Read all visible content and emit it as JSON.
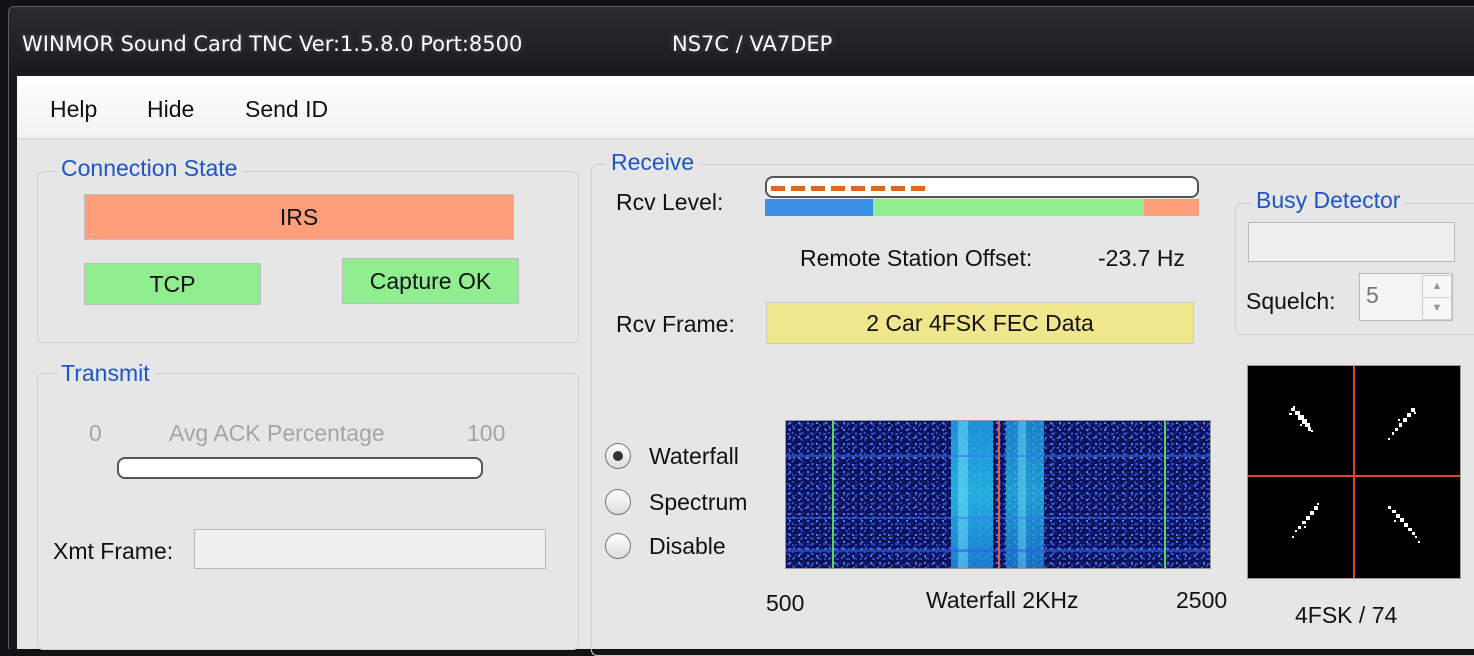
{
  "titlebar": {
    "title": "WINMOR Sound Card TNC Ver:1.5.8.0 Port:8500",
    "callsigns": "NS7C / VA7DEP"
  },
  "menu": {
    "items": [
      "Help",
      "Hide",
      "Send ID"
    ]
  },
  "connection_state": {
    "group_label": "Connection State",
    "state": "IRS",
    "tcp": "TCP",
    "capture": "Capture OK",
    "colors": {
      "irs": "#ff9e7a",
      "ok": "#90ee90"
    }
  },
  "transmit": {
    "group_label": "Transmit",
    "ack_min": "0",
    "ack_label": "Avg ACK Percentage",
    "ack_max": "100",
    "ack_percentage": 0,
    "xmt_frame_label": "Xmt Frame:",
    "xmt_frame_value": ""
  },
  "receive": {
    "group_label": "Receive",
    "rcv_level_label": "Rcv Level:",
    "rcv_level_fraction": 0.37,
    "remote_offset_label": "Remote Station Offset:",
    "remote_offset_value": "-23.7 Hz",
    "rcv_frame_label": "Rcv Frame:",
    "rcv_frame_value": "2 Car 4FSK FEC Data",
    "frame_color": "#f0e68c",
    "display_options": [
      {
        "label": "Waterfall",
        "selected": true
      },
      {
        "label": "Spectrum",
        "selected": false
      },
      {
        "label": "Disable",
        "selected": false
      }
    ],
    "waterfall_low": "500",
    "waterfall_label": "Waterfall 2KHz",
    "waterfall_high": "2500"
  },
  "busy_detector": {
    "group_label": "Busy Detector",
    "squelch_label": "Squelch:",
    "squelch_value": "5"
  },
  "constellation": {
    "caption": "4FSK / 74"
  }
}
